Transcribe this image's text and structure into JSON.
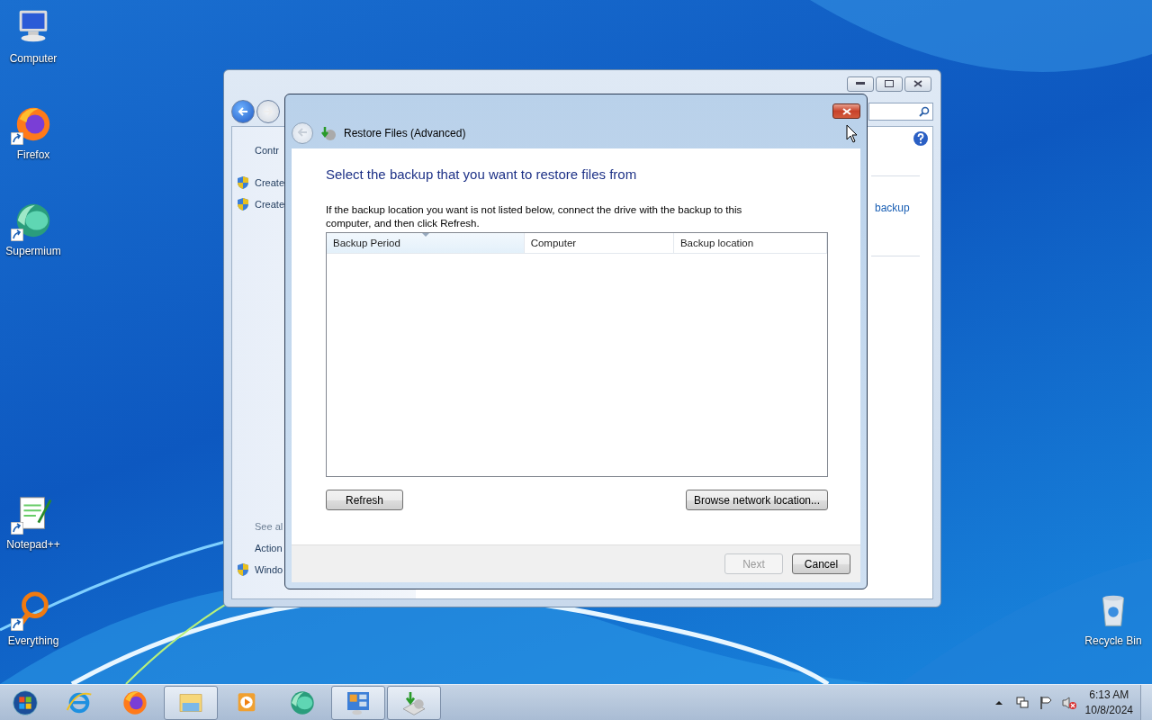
{
  "desktop_icons": [
    {
      "label": "Computer",
      "kind": "computer",
      "shortcut": false
    },
    {
      "label": "Firefox",
      "kind": "firefox",
      "shortcut": true
    },
    {
      "label": "Supermium",
      "kind": "supermium",
      "shortcut": true
    },
    {
      "label": "Notepad++",
      "kind": "notepad",
      "shortcut": true
    },
    {
      "label": "Everything",
      "kind": "everything",
      "shortcut": true
    },
    {
      "label": "Recycle Bin",
      "kind": "recycle",
      "shortcut": false
    }
  ],
  "background_window": {
    "nav_items": [
      {
        "label": "Contr",
        "kind": "text"
      },
      {
        "label": "Create",
        "kind": "shield"
      },
      {
        "label": "Create",
        "kind": "shield"
      }
    ],
    "see_also": {
      "label": "See al",
      "items": [
        {
          "label": "Action",
          "kind": "text"
        },
        {
          "label": "Windo",
          "kind": "shield"
        }
      ]
    },
    "link": "backup"
  },
  "dialog": {
    "title": "Restore Files (Advanced)",
    "heading": "Select the backup that you want to restore files from",
    "instruction": "If the backup location you want is not listed below, connect the drive with the backup to this computer, and then click Refresh.",
    "table": {
      "columns": [
        {
          "label": "Backup Period",
          "sorted": true
        },
        {
          "label": "Computer",
          "sorted": false
        },
        {
          "label": "Backup location",
          "sorted": false
        }
      ]
    },
    "actions": [
      {
        "label": "Refresh"
      },
      {
        "label": "Browse network location..."
      }
    ],
    "footer_buttons": [
      {
        "label": "Next",
        "disabled": true
      },
      {
        "label": "Cancel",
        "disabled": false
      }
    ]
  },
  "taskbar": {
    "items": [
      {
        "kind": "ie",
        "active": false
      },
      {
        "kind": "firefox",
        "active": false
      },
      {
        "kind": "explorer",
        "active": true
      },
      {
        "kind": "media",
        "active": false
      },
      {
        "kind": "supermium",
        "active": false
      },
      {
        "kind": "control-panel",
        "active": true
      },
      {
        "kind": "backup",
        "active": true
      }
    ],
    "time": "6:13 AM",
    "date": "10/8/2024"
  }
}
